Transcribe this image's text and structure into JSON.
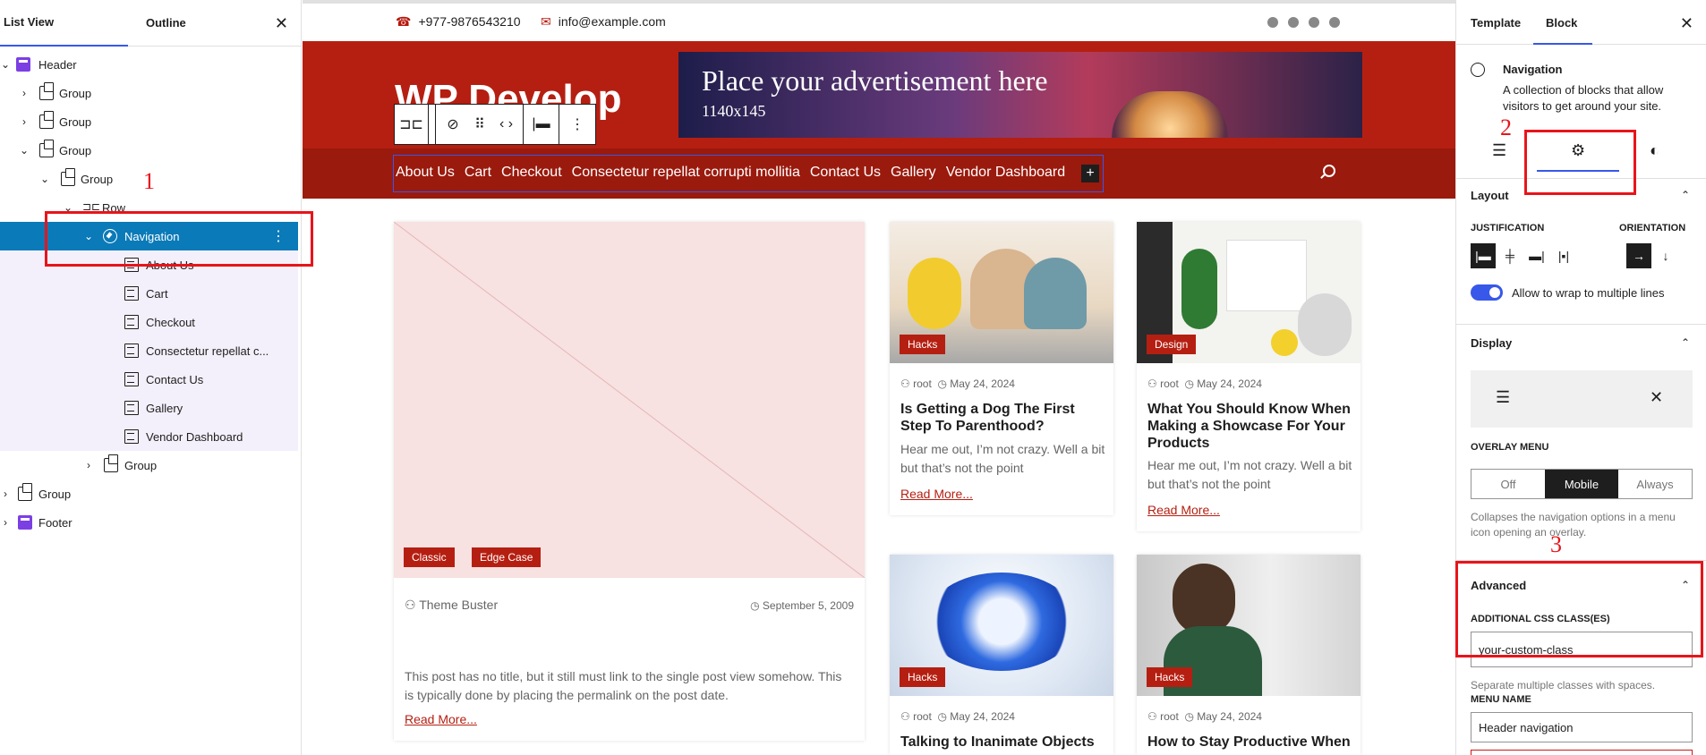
{
  "list_view": {
    "tabs": [
      "List View",
      "Outline"
    ],
    "close": "✕",
    "rows": [
      {
        "label": "Header",
        "chev": "⌄",
        "icon": "template"
      },
      {
        "label": "Group",
        "chev": "›",
        "icon": "group"
      },
      {
        "label": "Group",
        "chev": "›",
        "icon": "group"
      },
      {
        "label": "Group",
        "chev": "⌄",
        "icon": "group"
      },
      {
        "label": "Group",
        "chev": "⌄",
        "icon": "group"
      },
      {
        "label": "Row",
        "chev": "⌄",
        "icon": "row"
      },
      {
        "label": "Navigation",
        "chev": "⌄",
        "icon": "navigation"
      },
      {
        "label": "About Us",
        "icon": "page"
      },
      {
        "label": "Cart",
        "icon": "page"
      },
      {
        "label": "Checkout",
        "icon": "page"
      },
      {
        "label": "Consectetur repellat c...",
        "icon": "page"
      },
      {
        "label": "Contact Us",
        "icon": "page"
      },
      {
        "label": "Gallery",
        "icon": "page"
      },
      {
        "label": "Vendor Dashboard",
        "icon": "page"
      },
      {
        "label": "Group",
        "chev": "›",
        "icon": "group"
      },
      {
        "label": "Group",
        "chev": "›",
        "icon": "group"
      },
      {
        "label": "Footer",
        "chev": "›",
        "icon": "template"
      }
    ]
  },
  "canvas": {
    "phone": "+977-9876543210",
    "email": "info@example.com",
    "site_title": "WP Develop",
    "ad_line1": "Place your advertisement here",
    "ad_line2": "1140x145",
    "nav_items": [
      "About Us",
      "Cart",
      "Checkout",
      "Consectetur repellat corrupti mollitia",
      "Contact Us",
      "Gallery",
      "Vendor Dashboard"
    ],
    "nav_add": "+",
    "feature": {
      "badges": [
        "Classic",
        "Edge Case"
      ],
      "author": "Theme Buster",
      "date": "September 5, 2009",
      "excerpt": "This post has no title, but it still must link to the single post view somehow. This is typically done by placing the permalink on the post date.",
      "read_more": "Read More..."
    },
    "cards": [
      {
        "badge": "Hacks",
        "author": "root",
        "date": "May 24, 2024",
        "title": "Is Getting a Dog The First Step To Parenthood?",
        "excerpt": "Hear me out, I’m not crazy. Well a bit but that’s not the point",
        "read_more": "Read More..."
      },
      {
        "badge": "Design",
        "author": "root",
        "date": "May 24, 2024",
        "title": "What You Should Know When Making a Showcase For Your Products",
        "excerpt": "Hear me out, I’m not crazy. Well a bit but that’s not the point",
        "read_more": "Read More..."
      },
      {
        "badge": "Hacks",
        "author": "root",
        "date": "May 24, 2024",
        "title": "Talking to Inanimate Objects"
      },
      {
        "badge": "Hacks",
        "author": "root",
        "date": "May 24, 2024",
        "title": "How to Stay Productive When"
      }
    ]
  },
  "sidebar": {
    "tabs": [
      "Template",
      "Block"
    ],
    "close": "✕",
    "block_title": "Navigation",
    "block_desc": "A collection of blocks that allow visitors to get around your site.",
    "layout": {
      "heading": "Layout",
      "justification_label": "JUSTIFICATION",
      "orientation_label": "ORIENTATION",
      "wrap_label": "Allow to wrap to multiple lines"
    },
    "display": {
      "heading": "Display",
      "overlay_label": "OVERLAY MENU",
      "options": [
        "Off",
        "Mobile",
        "Always"
      ],
      "selected": "Mobile",
      "help": "Collapses the navigation options in a menu icon opening an overlay."
    },
    "advanced": {
      "heading": "Advanced",
      "css_label": "ADDITIONAL CSS CLASS(ES)",
      "css_value": "your-custom-class",
      "css_help": "Separate multiple classes with spaces.",
      "menu_name_label": "MENU NAME",
      "menu_name_value": "Header navigation"
    }
  },
  "annotations": [
    "1",
    "2",
    "3"
  ],
  "colors": {
    "accent": "#3858e9",
    "brand_red": "#b51f11",
    "annotation_red": "#e8141b",
    "selected_row": "#0a7ab8"
  }
}
